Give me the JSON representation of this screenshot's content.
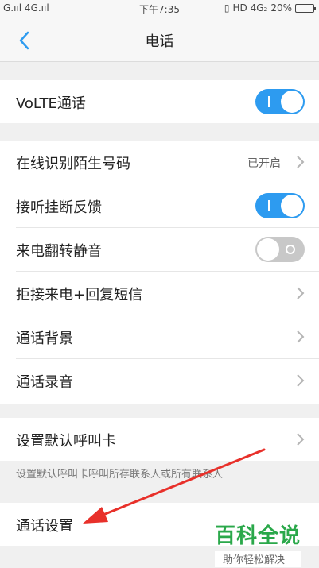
{
  "status_bar": {
    "signal": "G.ııl 4G.ııl",
    "time": "下午7:35",
    "indicators": "HD 4G₂",
    "battery": "20%",
    "battery_level": 0.2
  },
  "header": {
    "title": "电话",
    "back_icon": "chevron-left-icon"
  },
  "settings": {
    "volte": {
      "label": "VoLTE通话",
      "enabled": true
    },
    "stranger_id": {
      "label": "在线识别陌生号码",
      "value": "已开启"
    },
    "answer_feedback": {
      "label": "接听挂断反馈",
      "enabled": true
    },
    "flip_mute": {
      "label": "来电翻转静音",
      "enabled": false
    },
    "reject_sms": {
      "label": "拒接来电+回复短信"
    },
    "call_background": {
      "label": "通话背景"
    },
    "call_recording": {
      "label": "通话录音"
    },
    "default_card": {
      "label": "设置默认呼叫卡"
    },
    "default_card_hint": "设置默认呼叫卡呼叫所存联系人或所有联系人",
    "call_settings": {
      "label": "通话设置"
    }
  },
  "watermark": {
    "main": "百科全说",
    "sub": "助你轻松解决"
  },
  "colors": {
    "accent": "#2d9bf0",
    "annotation_arrow": "#e8302a",
    "watermark_green": "#2aa84a"
  }
}
